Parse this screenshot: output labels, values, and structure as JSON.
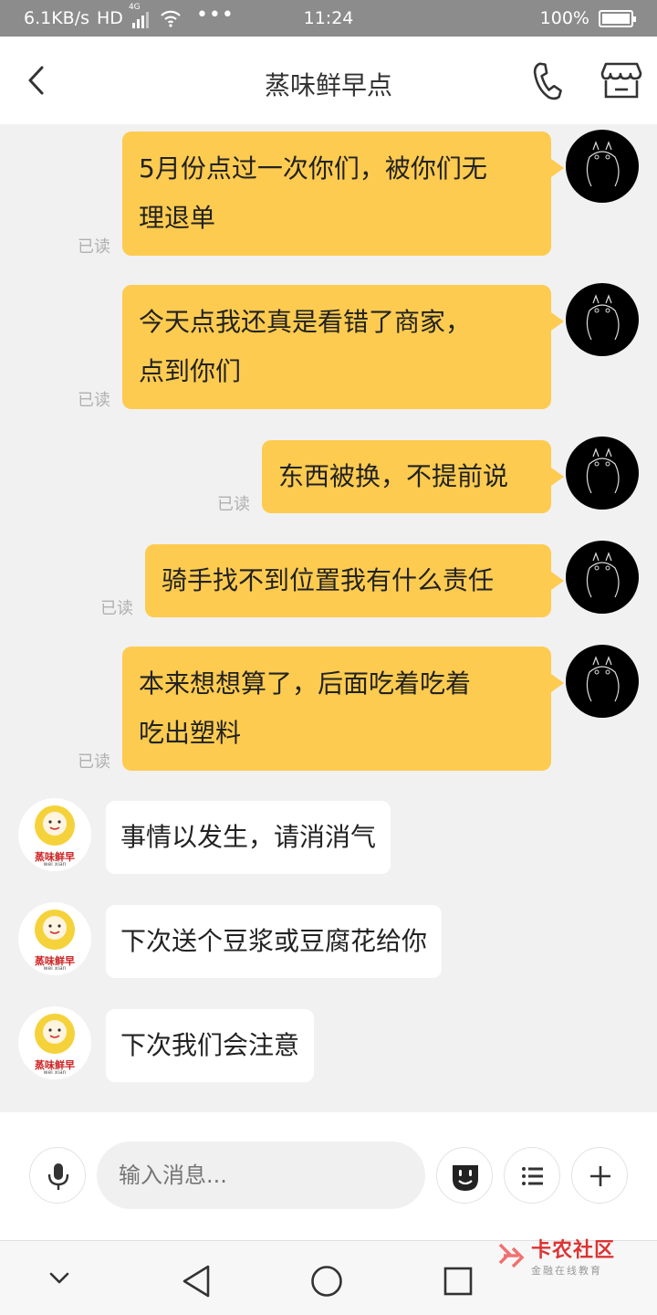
{
  "status_bar": {
    "speed": "6.1KB/s",
    "hd": "HD",
    "network": "4G",
    "more": "•••",
    "time": "11:24",
    "battery": "100%"
  },
  "header": {
    "title": "蒸味鲜早点"
  },
  "messages": [
    {
      "from": "me",
      "lines": [
        "5月份点过一次你们，被你们无",
        "理退单"
      ],
      "status": "已读"
    },
    {
      "from": "me",
      "lines": [
        "今天点我还真是看错了商家，",
        "点到你们"
      ],
      "status": "已读"
    },
    {
      "from": "me",
      "lines": [
        "东西被换，不提前说"
      ],
      "status": "已读"
    },
    {
      "from": "me",
      "lines": [
        "骑手找不到位置我有什么责任"
      ],
      "status": "已读"
    },
    {
      "from": "me",
      "lines": [
        "本来想想算了，后面吃着吃着",
        "吃出塑料"
      ],
      "status": "已读"
    },
    {
      "from": "shop",
      "text": "事情以发生，请消消气"
    },
    {
      "from": "shop",
      "text": "下次送个豆浆或豆腐花给你"
    },
    {
      "from": "shop",
      "text": "下次我们会注意"
    }
  ],
  "shop_logo": {
    "name": "蒸味鲜早",
    "sub": "wei xian"
  },
  "input": {
    "placeholder": "输入消息..."
  },
  "watermark": {
    "title": "卡农社区",
    "subtitle": "金融在线教育"
  },
  "colors": {
    "my_bubble": "#fdcb50",
    "shop_bubble": "#ffffff",
    "background": "#f1f1f1",
    "status_bar": "#8c8c8c"
  },
  "icons": {
    "back": "chevron-left-icon",
    "phone": "phone-icon",
    "shop": "store-icon",
    "voice": "microphone-icon",
    "emoji": "emoji-icon",
    "menu": "list-icon",
    "plus": "plus-icon",
    "nav_down": "chevron-down-icon",
    "nav_back": "triangle-back-icon",
    "nav_home": "circle-home-icon",
    "nav_recent": "square-recent-icon"
  }
}
